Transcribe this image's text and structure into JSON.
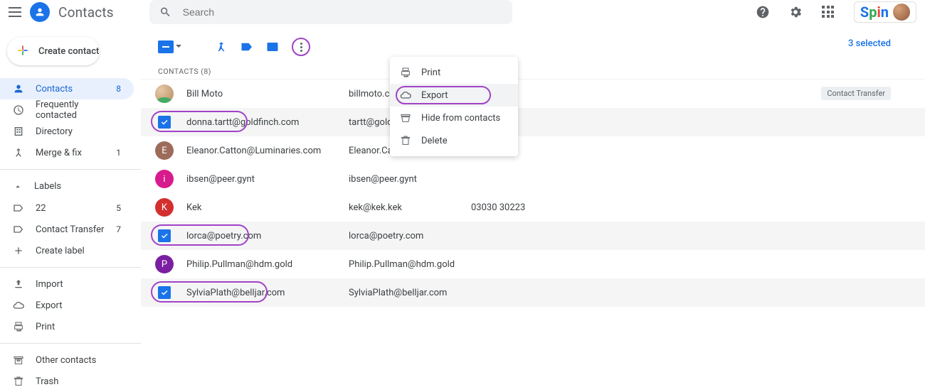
{
  "header": {
    "app_title": "Contacts",
    "search_placeholder": "Search",
    "spin_label": "Spin"
  },
  "sidebar": {
    "create_label": "Create contact",
    "items": [
      {
        "icon": "person",
        "label": "Contacts",
        "count": "8",
        "active": true
      },
      {
        "icon": "clock",
        "label": "Frequently contacted",
        "count": ""
      },
      {
        "icon": "building",
        "label": "Directory",
        "count": ""
      },
      {
        "icon": "merge",
        "label": "Merge & fix",
        "count": "1"
      }
    ],
    "labels_heading": "Labels",
    "labels": [
      {
        "icon": "tag",
        "label": "22",
        "count": "5"
      },
      {
        "icon": "tag",
        "label": "Contact Transfer",
        "count": "7"
      },
      {
        "icon": "plus",
        "label": "Create label",
        "count": ""
      }
    ],
    "actions": [
      {
        "icon": "upload",
        "label": "Import"
      },
      {
        "icon": "cloud",
        "label": "Export"
      },
      {
        "icon": "print",
        "label": "Print"
      }
    ],
    "bottom": [
      {
        "icon": "archive",
        "label": "Other contacts"
      },
      {
        "icon": "trash",
        "label": "Trash"
      }
    ]
  },
  "selection_count": "3 selected",
  "list_heading": "CONTACTS (8)",
  "dropdown": {
    "items": [
      {
        "icon": "print",
        "label": "Print"
      },
      {
        "icon": "cloud",
        "label": "Export",
        "highlight": true
      },
      {
        "icon": "hide",
        "label": "Hide from contacts"
      },
      {
        "icon": "trash",
        "label": "Delete"
      }
    ]
  },
  "contacts": [
    {
      "selected": false,
      "avatar_type": "face",
      "avatar_letter": "",
      "avatar_color": "",
      "name": "Bill Moto",
      "email": "billmoto.com",
      "phone": "",
      "chip": "Contact Transfer"
    },
    {
      "selected": true,
      "avatar_type": "check",
      "avatar_letter": "",
      "avatar_color": "",
      "name": "donna.tartt@goldfinch.com",
      "email": "tartt@goldfinch.com",
      "phone": "",
      "hl_width": 136
    },
    {
      "selected": false,
      "avatar_type": "letter",
      "avatar_letter": "E",
      "avatar_color": "#9c6b5a",
      "name": "Eleanor.Catton@Luminaries.com",
      "email": "Eleanor.Catton@Luminaries.com",
      "phone": ""
    },
    {
      "selected": false,
      "avatar_type": "letter",
      "avatar_letter": "i",
      "avatar_color": "#d81b8c",
      "name": "ibsen@peer.gynt",
      "email": "ibsen@peer.gynt",
      "phone": ""
    },
    {
      "selected": false,
      "avatar_type": "letter",
      "avatar_letter": "K",
      "avatar_color": "#d32f2f",
      "name": "Kek",
      "email": "kek@kek.kek",
      "phone": "03030 30223"
    },
    {
      "selected": true,
      "avatar_type": "check",
      "avatar_letter": "",
      "avatar_color": "",
      "name": "lorca@poetry.com",
      "email": "lorca@poetry.com",
      "phone": "",
      "hl_width": 138
    },
    {
      "selected": false,
      "avatar_type": "letter",
      "avatar_letter": "P",
      "avatar_color": "#7b1fa2",
      "name": "Philip.Pullman@hdm.gold",
      "email": "Philip.Pullman@hdm.gold",
      "phone": ""
    },
    {
      "selected": true,
      "avatar_type": "check",
      "avatar_letter": "",
      "avatar_color": "",
      "name": "SylviaPlath@belljar.com",
      "email": "SylviaPlath@belljar.com",
      "phone": "",
      "hl_width": 164
    }
  ]
}
